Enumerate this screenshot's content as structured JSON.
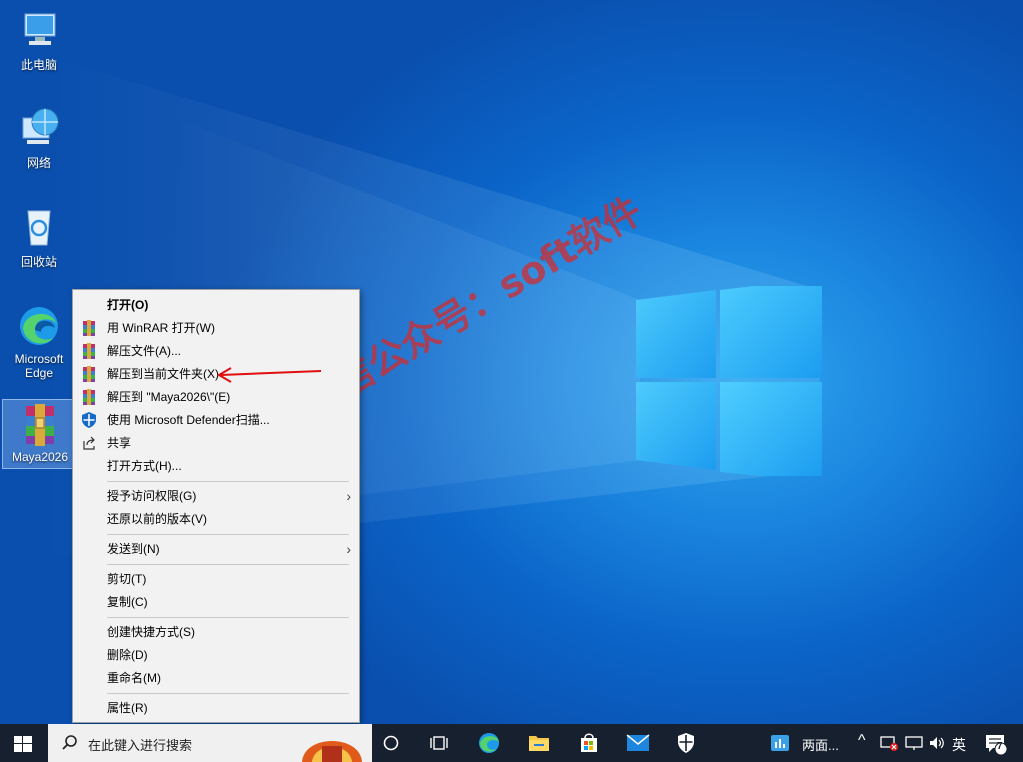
{
  "desktop": {
    "icons": [
      {
        "label": "此电脑",
        "icon": "computer-icon"
      },
      {
        "label": "网络",
        "icon": "network-icon"
      },
      {
        "label": "回收站",
        "icon": "recycle-bin-icon"
      },
      {
        "label": "Microsoft Edge",
        "icon": "edge-icon"
      },
      {
        "label": "Maya2026",
        "icon": "winrar-archive-icon"
      }
    ],
    "watermark": "微信公众号：soft软件"
  },
  "context_menu": {
    "items": [
      {
        "label": "打开(O)",
        "icon": ""
      },
      {
        "label": "用 WinRAR 打开(W)",
        "icon": "winrar-icon"
      },
      {
        "label": "解压文件(A)...",
        "icon": "winrar-icon"
      },
      {
        "label": "解压到当前文件夹(X)",
        "icon": "winrar-icon"
      },
      {
        "label": "解压到 \"Maya2026\\\"(E)",
        "icon": "winrar-icon"
      },
      {
        "label": "使用 Microsoft Defender扫描...",
        "icon": "defender-shield-icon"
      },
      {
        "label": "共享",
        "icon": "share-icon"
      },
      {
        "label": "打开方式(H)...",
        "icon": ""
      },
      {
        "label": "授予访问权限(G)",
        "icon": ""
      },
      {
        "label": "还原以前的版本(V)",
        "icon": ""
      },
      {
        "label": "发送到(N)",
        "icon": ""
      },
      {
        "label": "剪切(T)",
        "icon": ""
      },
      {
        "label": "复制(C)",
        "icon": ""
      },
      {
        "label": "创建快捷方式(S)",
        "icon": ""
      },
      {
        "label": "删除(D)",
        "icon": ""
      },
      {
        "label": "重命名(M)",
        "icon": ""
      },
      {
        "label": "属性(R)",
        "icon": ""
      }
    ]
  },
  "taskbar": {
    "search_placeholder": "在此键入进行搜索",
    "widget_label": "两面...",
    "ime": "英",
    "notification_count": "7"
  },
  "colors": {
    "taskbar_bg": "#17202e",
    "menu_bg": "#f2f2f2",
    "watermark": "#d72828",
    "arrow": "#e01010"
  }
}
